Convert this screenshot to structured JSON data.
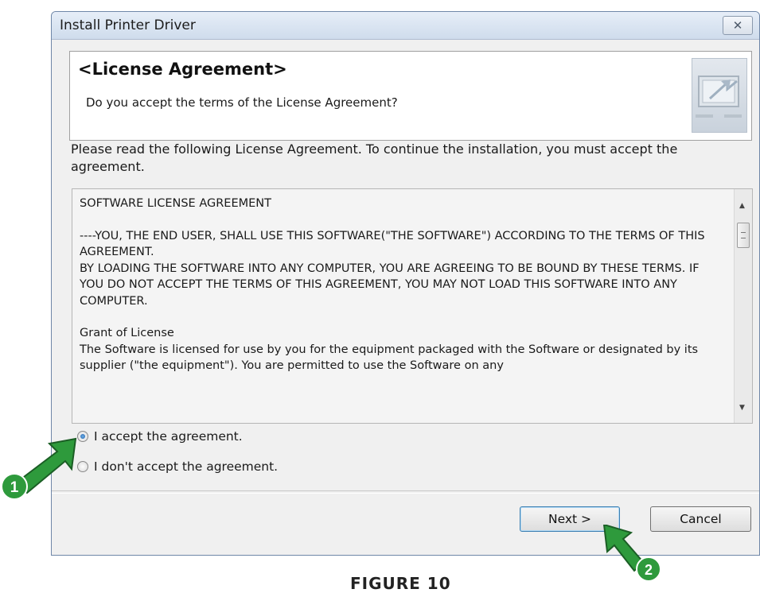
{
  "window": {
    "title": "Install Printer Driver",
    "close_symbol": "✕"
  },
  "header": {
    "title": "<License Agreement>",
    "subtitle": "Do you accept the terms of the License Agreement?",
    "icon": "install-computer-icon"
  },
  "instructions": "Please read the following License Agreement. To continue the installation, you must accept the agreement.",
  "license": {
    "paragraphs": [
      "SOFTWARE LICENSE AGREEMENT",
      "----YOU, THE END USER, SHALL USE THIS SOFTWARE(\"THE SOFTWARE\") ACCORDING TO THE TERMS OF THIS AGREEMENT.\nBY LOADING THE SOFTWARE INTO ANY COMPUTER, YOU ARE AGREEING TO BE BOUND BY THESE TERMS. IF YOU DO NOT ACCEPT THE TERMS OF THIS AGREEMENT, YOU MAY NOT LOAD THIS SOFTWARE INTO ANY COMPUTER.",
      "Grant of License\nThe Software is licensed for use by you for the equipment packaged with the Software or designated by its supplier (\"the equipment\"). You are permitted to use the Software on any"
    ]
  },
  "options": {
    "accept_label": "I accept the agreement.",
    "reject_label": "I don't accept the agreement.",
    "selected": "accept"
  },
  "buttons": {
    "next_label": "Next >",
    "cancel_label": "Cancel"
  },
  "annotations": {
    "marker1_label": "1",
    "marker2_label": "2",
    "arrow_color": "#2e9a3c"
  },
  "caption": "FIGURE 10"
}
